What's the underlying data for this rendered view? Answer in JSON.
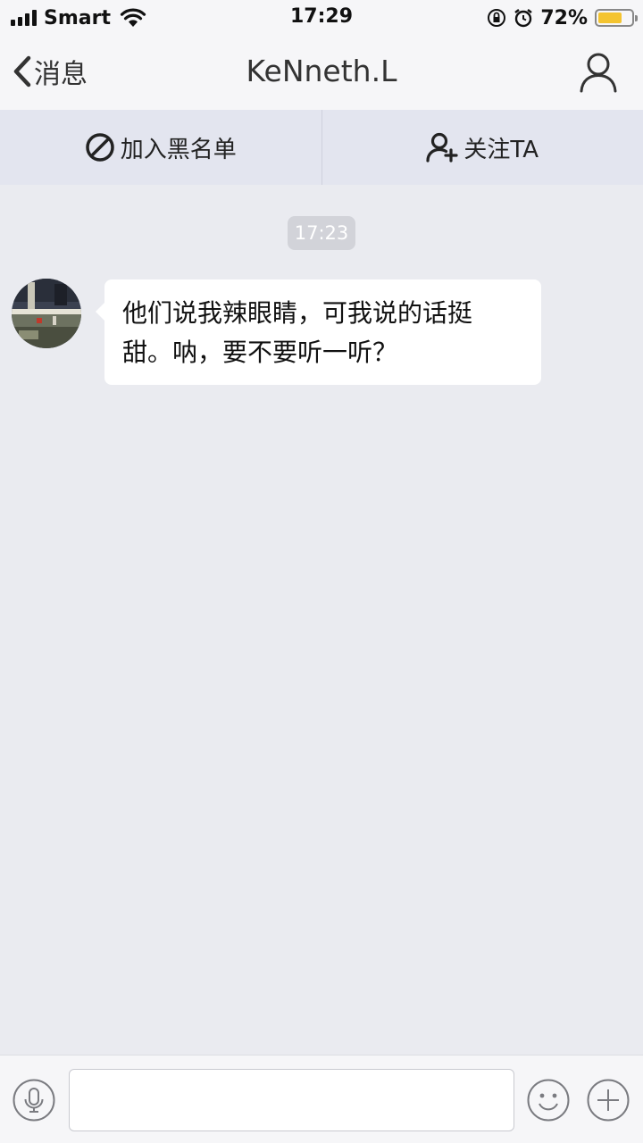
{
  "status_bar": {
    "carrier": "Smart",
    "time": "17:29",
    "battery_percent": "72%",
    "battery_level": 0.72,
    "icons": [
      "signal-icon",
      "wifi-icon",
      "orientation-lock-icon",
      "alarm-icon",
      "battery-icon"
    ]
  },
  "nav": {
    "back_label": "消息",
    "title": "KeNneth.L",
    "right_icon": "person-icon"
  },
  "actions": {
    "block_label": "加入黑名单",
    "block_icon": "block-icon",
    "follow_label": "关注TA",
    "follow_icon": "add-person-icon"
  },
  "chat": {
    "timestamp": "17:23",
    "messages": [
      {
        "sender": "KeNneth.L",
        "line1": "他们说我辣眼睛，可我说的话挺",
        "line2": "甜。呐，要不要听一听？"
      }
    ]
  },
  "input_bar": {
    "placeholder": "",
    "value": "",
    "icons": [
      "microphone-icon",
      "emoji-icon",
      "plus-icon"
    ]
  },
  "colors": {
    "background": "#eaebf0",
    "bar": "#f6f6f8",
    "action_bar": "#e3e5ef",
    "battery_fill": "#f4c430"
  }
}
